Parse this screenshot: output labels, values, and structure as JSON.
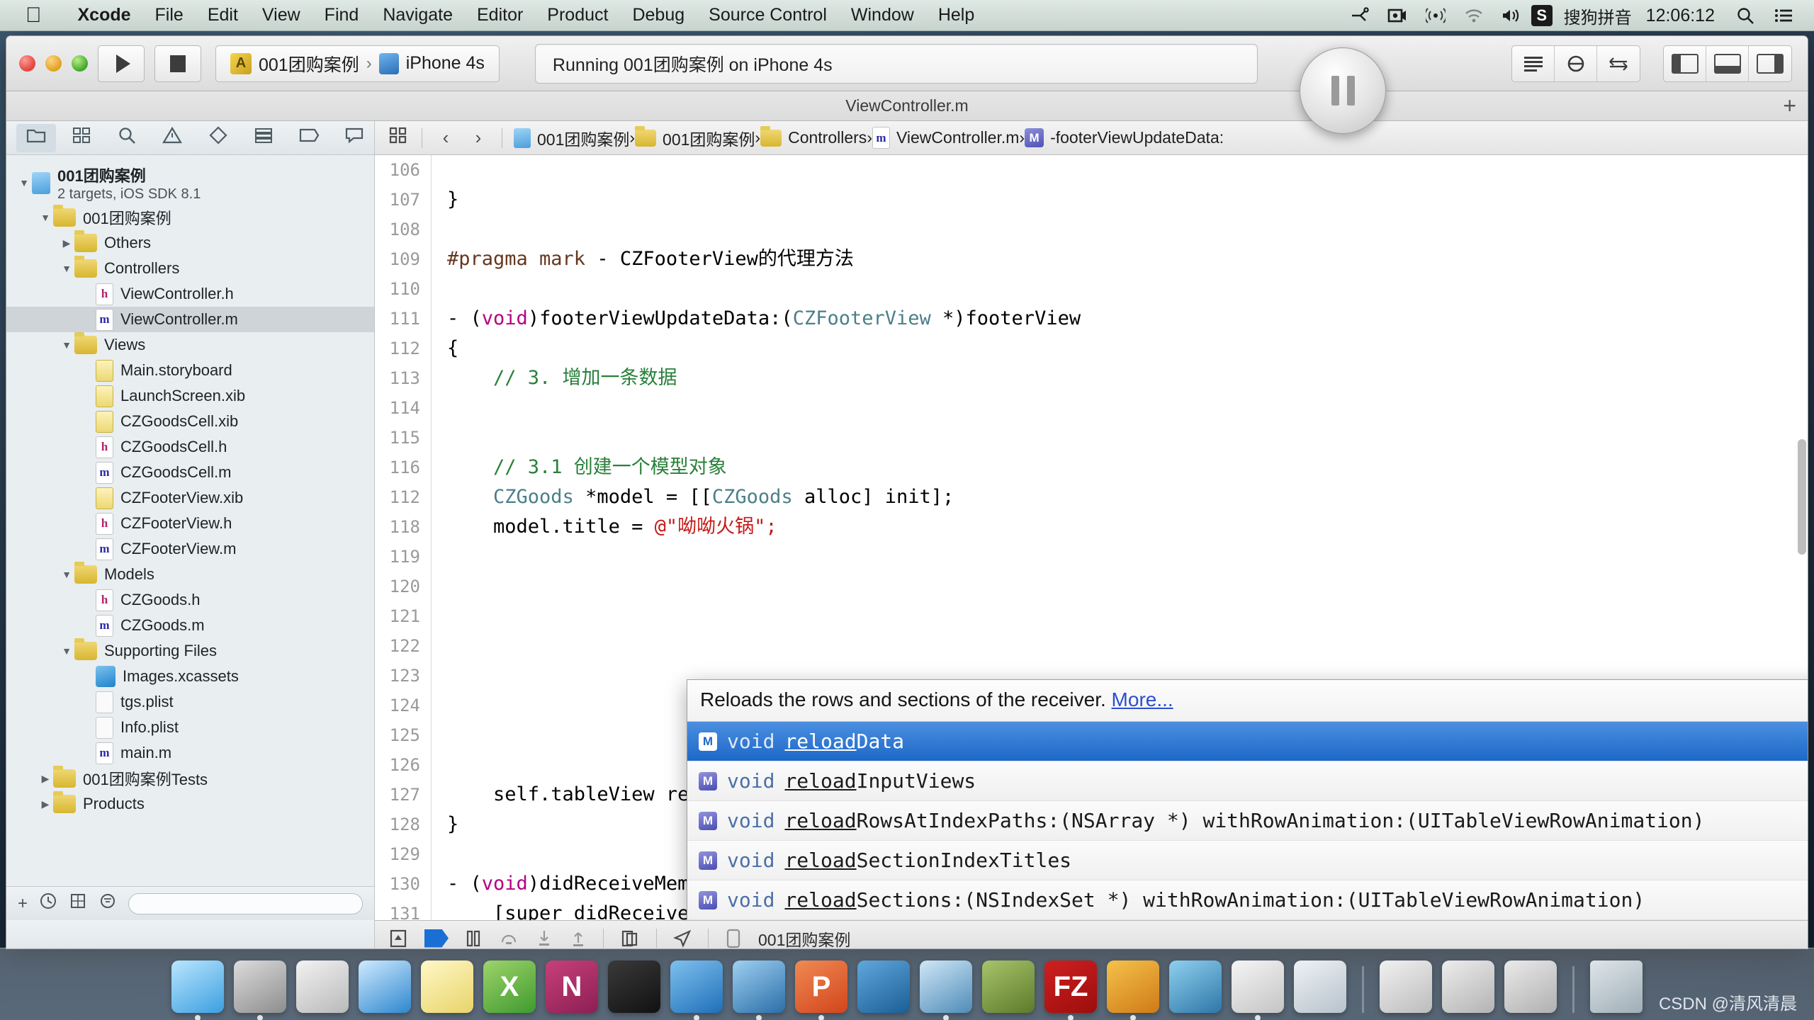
{
  "menubar": {
    "apple_icon": "apple-logo-icon",
    "items": [
      {
        "label": "Xcode",
        "bold": true
      },
      {
        "label": "File",
        "bold": false
      },
      {
        "label": "Edit",
        "bold": false
      },
      {
        "label": "View",
        "bold": false
      },
      {
        "label": "Find",
        "bold": false
      },
      {
        "label": "Navigate",
        "bold": false
      },
      {
        "label": "Editor",
        "bold": false
      },
      {
        "label": "Product",
        "bold": false
      },
      {
        "label": "Debug",
        "bold": false
      },
      {
        "label": "Source Control",
        "bold": false
      },
      {
        "label": "Window",
        "bold": false
      },
      {
        "label": "Help",
        "bold": false
      }
    ],
    "status": {
      "icons": [
        "bluetooth-share-icon",
        "screen-record-icon",
        "airplay-icon",
        "wifi-icon",
        "volume-icon"
      ],
      "ime_badge": "S",
      "ime_label": "搜狗拼音",
      "clock": "12:06:12",
      "search_icon": "search-icon",
      "notification_icon": "notification-center-icon"
    }
  },
  "toolbar": {
    "run_button": "run-button",
    "stop_button": "stop-button",
    "scheme_name": "001团购案例",
    "destination_name": "iPhone 4s",
    "status_text": "Running 001团购案例 on iPhone 4s",
    "pause_button_label": "pause-button",
    "editor_segments": [
      "standard-editor-icon",
      "assistant-editor-icon",
      "version-editor-icon"
    ],
    "view_segments": [
      "navigator-toggle-icon",
      "debug-area-toggle-icon",
      "utilities-toggle-icon"
    ],
    "add_tab_label": "+"
  },
  "titlebar": {
    "filename": "ViewController.m"
  },
  "navigator": {
    "tabs": [
      {
        "name": "project-navigator-tab",
        "icon": "folder-icon",
        "active": true
      },
      {
        "name": "symbol-navigator-tab",
        "icon": "symbol-icon",
        "active": false
      },
      {
        "name": "find-navigator-tab",
        "icon": "search-icon",
        "active": false
      },
      {
        "name": "issue-navigator-tab",
        "icon": "warning-icon",
        "active": false
      },
      {
        "name": "test-navigator-tab",
        "icon": "diamond-icon",
        "active": false
      },
      {
        "name": "debug-navigator-tab",
        "icon": "debug-icon",
        "active": false
      },
      {
        "name": "breakpoint-navigator-tab",
        "icon": "breakpoint-icon",
        "active": false
      },
      {
        "name": "log-navigator-tab",
        "icon": "log-icon",
        "active": false
      }
    ],
    "tree": [
      {
        "indent": 0,
        "twist": "open",
        "icon": "proj",
        "label": "001团购案例",
        "sub": "2 targets, iOS SDK 8.1",
        "bold": true,
        "selected": false
      },
      {
        "indent": 1,
        "twist": "open",
        "icon": "folder",
        "label": "001团购案例",
        "selected": false
      },
      {
        "indent": 2,
        "twist": "closed",
        "icon": "folder",
        "label": "Others",
        "selected": false
      },
      {
        "indent": 2,
        "twist": "open",
        "icon": "folder",
        "label": "Controllers",
        "selected": false
      },
      {
        "indent": 3,
        "twist": "none",
        "icon": "src-h",
        "label": "ViewController.h",
        "selected": false
      },
      {
        "indent": 3,
        "twist": "none",
        "icon": "src-m",
        "label": "ViewController.m",
        "selected": true
      },
      {
        "indent": 2,
        "twist": "open",
        "icon": "folder",
        "label": "Views",
        "selected": false
      },
      {
        "indent": 3,
        "twist": "none",
        "icon": "xib",
        "label": "Main.storyboard",
        "selected": false
      },
      {
        "indent": 3,
        "twist": "none",
        "icon": "xib",
        "label": "LaunchScreen.xib",
        "selected": false
      },
      {
        "indent": 3,
        "twist": "none",
        "icon": "xib",
        "label": "CZGoodsCell.xib",
        "selected": false
      },
      {
        "indent": 3,
        "twist": "none",
        "icon": "src-h",
        "label": "CZGoodsCell.h",
        "selected": false
      },
      {
        "indent": 3,
        "twist": "none",
        "icon": "src-m",
        "label": "CZGoodsCell.m",
        "selected": false
      },
      {
        "indent": 3,
        "twist": "none",
        "icon": "xib",
        "label": "CZFooterView.xib",
        "selected": false
      },
      {
        "indent": 3,
        "twist": "none",
        "icon": "src-h",
        "label": "CZFooterView.h",
        "selected": false
      },
      {
        "indent": 3,
        "twist": "none",
        "icon": "src-m",
        "label": "CZFooterView.m",
        "selected": false
      },
      {
        "indent": 2,
        "twist": "open",
        "icon": "folder",
        "label": "Models",
        "selected": false
      },
      {
        "indent": 3,
        "twist": "none",
        "icon": "src-h",
        "label": "CZGoods.h",
        "selected": false
      },
      {
        "indent": 3,
        "twist": "none",
        "icon": "src-m",
        "label": "CZGoods.m",
        "selected": false
      },
      {
        "indent": 2,
        "twist": "open",
        "icon": "folder",
        "label": "Supporting Files",
        "selected": false
      },
      {
        "indent": 3,
        "twist": "none",
        "icon": "assets",
        "label": "Images.xcassets",
        "selected": false
      },
      {
        "indent": 3,
        "twist": "none",
        "icon": "plist",
        "label": "tgs.plist",
        "selected": false
      },
      {
        "indent": 3,
        "twist": "none",
        "icon": "plist",
        "label": "Info.plist",
        "selected": false
      },
      {
        "indent": 3,
        "twist": "none",
        "icon": "src-m",
        "label": "main.m",
        "selected": false
      },
      {
        "indent": 1,
        "twist": "closed",
        "icon": "folder",
        "label": "001团购案例Tests",
        "selected": false
      },
      {
        "indent": 1,
        "twist": "closed",
        "icon": "folder",
        "label": "Products",
        "selected": false
      }
    ],
    "footer": {
      "add_label": "+",
      "recent_icon": "clock-icon",
      "source_control_icon": "source-control-icon",
      "filter_icon": "filter-icon",
      "filter_placeholder": ""
    }
  },
  "jumpbar": {
    "related_icon": "related-items-icon",
    "back_icon": "back-chevron-icon",
    "forward_icon": "forward-chevron-icon",
    "crumbs": [
      {
        "icon": "proj",
        "label": "001团购案例"
      },
      {
        "icon": "folder",
        "label": "001团购案例"
      },
      {
        "icon": "folder",
        "label": "Controllers"
      },
      {
        "icon": "src-m",
        "label": "ViewController.m"
      },
      {
        "icon": "method",
        "label": "-footerViewUpdateData:"
      }
    ]
  },
  "code": {
    "lines": [
      {
        "num": "106",
        "segs": [
          {
            "t": "",
            "c": ""
          }
        ]
      },
      {
        "num": "107",
        "segs": [
          {
            "t": "}",
            "c": ""
          }
        ]
      },
      {
        "num": "108",
        "segs": [
          {
            "t": "",
            "c": ""
          }
        ]
      },
      {
        "num": "109",
        "segs": [
          {
            "t": "#pragma mark ",
            "c": "pre"
          },
          {
            "t": "- CZFooterView的代理方法",
            "c": ""
          }
        ]
      },
      {
        "num": "110",
        "segs": [
          {
            "t": "",
            "c": ""
          }
        ]
      },
      {
        "num": "111",
        "segs": [
          {
            "t": "- (",
            "c": ""
          },
          {
            "t": "void",
            "c": "kw"
          },
          {
            "t": ")footerViewUpdateData:(",
            "c": ""
          },
          {
            "t": "CZFooterView",
            "c": "cls"
          },
          {
            "t": " *)footerView",
            "c": ""
          }
        ]
      },
      {
        "num": "112",
        "segs": [
          {
            "t": "{",
            "c": ""
          }
        ]
      },
      {
        "num": "113",
        "segs": [
          {
            "t": "    // 3. 增加一条数据",
            "c": "cm"
          }
        ]
      },
      {
        "num": "114",
        "segs": [
          {
            "t": "",
            "c": ""
          }
        ]
      },
      {
        "num": "115",
        "segs": [
          {
            "t": "",
            "c": ""
          }
        ]
      },
      {
        "num": "116",
        "segs": [
          {
            "t": "    // 3.1 创建一个模型对象",
            "c": "cm"
          }
        ]
      },
      {
        "num": "112",
        "segs": [
          {
            "t": "    ",
            "c": ""
          },
          {
            "t": "CZGoods",
            "c": "cls"
          },
          {
            "t": " *model = [[",
            "c": ""
          },
          {
            "t": "CZGoods",
            "c": "cls"
          },
          {
            "t": " alloc] init];",
            "c": ""
          }
        ]
      },
      {
        "num": "118",
        "segs": [
          {
            "t": "    model.title = ",
            "c": ""
          },
          {
            "t": "@\"呦呦火锅\";",
            "c": "str"
          }
        ]
      },
      {
        "num": "119",
        "segs": [
          {
            "t": "",
            "c": ""
          }
        ]
      },
      {
        "num": "120",
        "segs": [
          {
            "t": "",
            "c": ""
          }
        ]
      },
      {
        "num": "121",
        "segs": [
          {
            "t": "",
            "c": ""
          }
        ]
      },
      {
        "num": "122",
        "segs": [
          {
            "t": "",
            "c": ""
          }
        ]
      },
      {
        "num": "123",
        "segs": [
          {
            "t": "",
            "c": ""
          }
        ]
      },
      {
        "num": "124",
        "segs": [
          {
            "t": "",
            "c": ""
          }
        ]
      },
      {
        "num": "125",
        "segs": [
          {
            "t": "",
            "c": ""
          }
        ]
      },
      {
        "num": "126",
        "segs": [
          {
            "t": "",
            "c": ""
          }
        ]
      },
      {
        "num": "127",
        "segs": [
          {
            "t": "    self.tableView reloa",
            "c": ""
          }
        ]
      },
      {
        "num": "128",
        "segs": [
          {
            "t": "}",
            "c": ""
          }
        ]
      },
      {
        "num": "129",
        "segs": [
          {
            "t": "",
            "c": ""
          }
        ]
      },
      {
        "num": "130",
        "segs": [
          {
            "t": "- (",
            "c": ""
          },
          {
            "t": "void",
            "c": "kw"
          },
          {
            "t": ")didReceiveMemoryWarning {",
            "c": ""
          }
        ]
      },
      {
        "num": "131",
        "segs": [
          {
            "t": "    [super didReceiveMemoryWarning];",
            "c": ""
          }
        ]
      }
    ],
    "typed_line_prefix": "    self.tableView reloa",
    "ghost_completion": "dData"
  },
  "completion": {
    "doc_text": "Reloads the rows and sections of the receiver.",
    "doc_more_label": "More...",
    "items": [
      {
        "badge": "M",
        "return_type": "void",
        "matched": "reload",
        "rest": "Data",
        "selected": true
      },
      {
        "badge": "M",
        "return_type": "void",
        "matched": "reload",
        "rest": "InputViews",
        "selected": false
      },
      {
        "badge": "M",
        "return_type": "void",
        "matched": "reload",
        "rest": "RowsAtIndexPaths:(NSArray *) withRowAnimation:(UITableViewRowAnimation)",
        "selected": false
      },
      {
        "badge": "M",
        "return_type": "void",
        "matched": "reload",
        "rest": "SectionIndexTitles",
        "selected": false
      },
      {
        "badge": "M",
        "return_type": "void",
        "matched": "reload",
        "rest": "Sections:(NSIndexSet *) withRowAnimation:(UITableViewRowAnimation)",
        "selected": false
      }
    ]
  },
  "debugbar": {
    "icons": [
      "hide-debug-area-icon",
      "continue-flag-icon",
      "pause-program-icon",
      "step-over-icon",
      "step-into-icon",
      "step-out-icon",
      "view-debugging-icon",
      "location-simulate-icon",
      "device-icon"
    ],
    "process_label": "001团购案例"
  },
  "dock": {
    "apps": [
      {
        "name": "finder",
        "glyph": "",
        "color1": "#b9e6ff",
        "color2": "#3d9fe0",
        "running": true
      },
      {
        "name": "system-preferences",
        "glyph": "",
        "color1": "#dcdcdc",
        "color2": "#8d8d8d",
        "running": true
      },
      {
        "name": "launchpad",
        "glyph": "",
        "color1": "#f2f2f2",
        "color2": "#b9b9b9",
        "running": false
      },
      {
        "name": "safari",
        "glyph": "",
        "color1": "#cfeaff",
        "color2": "#2e87cf",
        "running": false
      },
      {
        "name": "notes",
        "glyph": "",
        "color1": "#fff8c7",
        "color2": "#e8d46a",
        "running": false
      },
      {
        "name": "microsoft-excel",
        "glyph": "X",
        "color1": "#9ed46a",
        "color2": "#3f9a2f",
        "running": false
      },
      {
        "name": "microsoft-onenote",
        "glyph": "N",
        "color1": "#c8407b",
        "color2": "#8b1f53",
        "running": false
      },
      {
        "name": "terminal",
        "glyph": "",
        "color1": "#3a3a3a",
        "color2": "#111111",
        "running": false
      },
      {
        "name": "xcode",
        "glyph": "",
        "color1": "#7fc1ef",
        "color2": "#1f6fb8",
        "running": true
      },
      {
        "name": "simulator",
        "glyph": "",
        "color1": "#9ed0f2",
        "color2": "#2b6ea8",
        "running": true
      },
      {
        "name": "microsoft-powerpoint",
        "glyph": "P",
        "color1": "#f08a54",
        "color2": "#d2451c",
        "running": true
      },
      {
        "name": "instruments",
        "glyph": "",
        "color1": "#5fa8dc",
        "color2": "#1b5e96",
        "running": false
      },
      {
        "name": "quicktime-player",
        "glyph": "",
        "color1": "#cfe7f7",
        "color2": "#4f8cb8",
        "running": true
      },
      {
        "name": "archive-utility",
        "glyph": "",
        "color1": "#a8c46a",
        "color2": "#5d7a2c",
        "running": false
      },
      {
        "name": "filezilla",
        "glyph": "FZ",
        "color1": "#cf2020",
        "color2": "#9c0d0d",
        "running": true
      },
      {
        "name": "image-viewer",
        "glyph": "",
        "color1": "#f5c24a",
        "color2": "#cf7a18",
        "running": true
      },
      {
        "name": "charles",
        "glyph": "",
        "color1": "#8fd0ef",
        "color2": "#2d77a8",
        "running": false
      },
      {
        "name": "preview",
        "glyph": "",
        "color1": "#f5f5f5",
        "color2": "#c4c4c4",
        "running": true
      },
      {
        "name": "app-extra",
        "glyph": "",
        "color1": "#eef2f5",
        "color2": "#b7c2cc",
        "running": false
      }
    ],
    "stacks": [
      {
        "name": "downloads-stack",
        "color1": "#f1f1f1",
        "color2": "#bcbcbc"
      },
      {
        "name": "documents-stack",
        "color1": "#ededed",
        "color2": "#b3b3b3"
      },
      {
        "name": "desktop-stack",
        "color1": "#eaeaea",
        "color2": "#b0b0b0"
      }
    ],
    "trash": {
      "name": "trash",
      "color1": "#dfe6ea",
      "color2": "#9fadb6"
    }
  },
  "watermark": "CSDN @清风清晨"
}
